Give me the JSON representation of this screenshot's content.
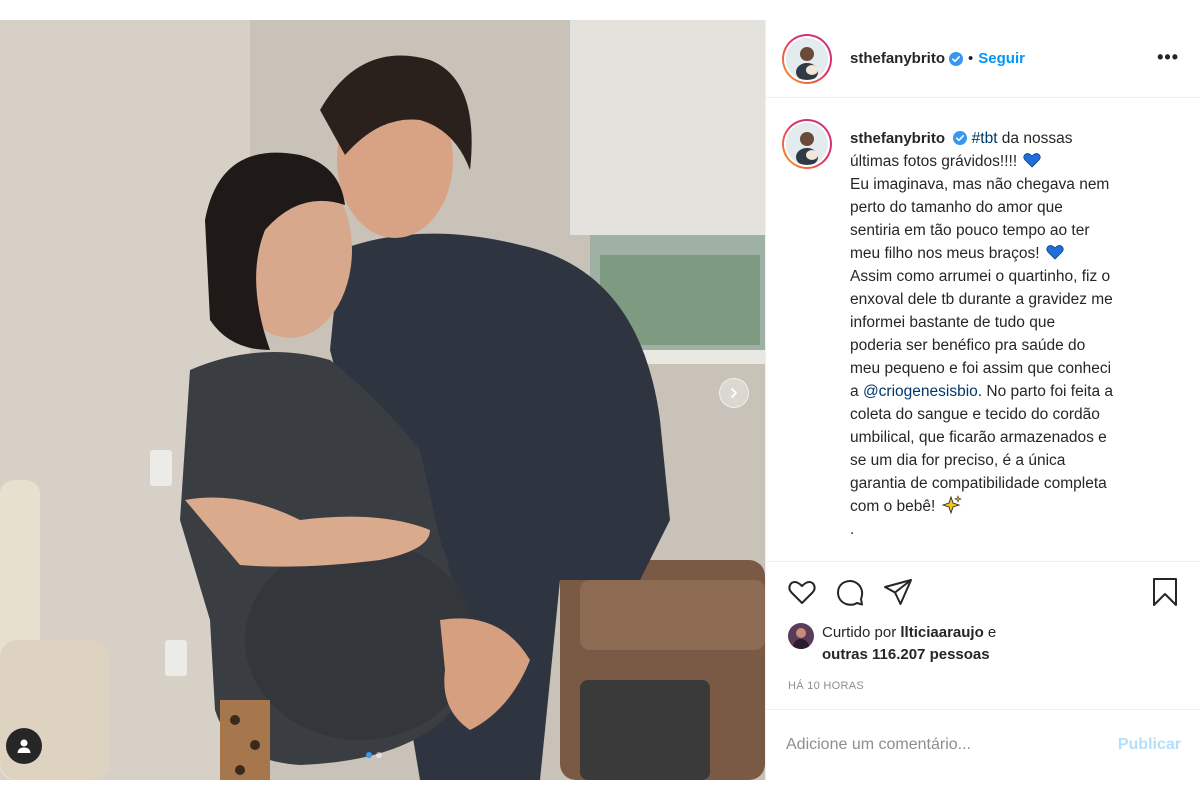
{
  "post": {
    "author": {
      "username": "sthefanybrito",
      "verified": true,
      "avatar_icon": "profile-avatar"
    },
    "header": {
      "separator": "•",
      "follow_label": "Seguir",
      "more_label": "•••"
    },
    "photo": {
      "description_icon": "photo-couple-kissing",
      "carousel_next_icon": "chevron-right-icon",
      "tag_icon": "user-tag-icon",
      "carousel_count": 2,
      "carousel_active": 1
    },
    "caption": {
      "username": "sthefanybrito",
      "hashtag": "#tbt",
      "line1_rest": " da nossas",
      "line2": "últimas fotos grávidos!!!! ",
      "line3": "Eu imaginava, mas não chegava nem",
      "line4": "perto do tamanho do amor que",
      "line5": "sentiria em tão pouco tempo ao ter",
      "line6": "meu filho nos meus braços! ",
      "line7": "Assim como arrumei o quartinho, fiz o",
      "line8": "enxoval dele tb durante a gravidez me",
      "line9": "informei bastante de tudo que",
      "line10": "poderia ser benéfico pra saúde do",
      "line11": "meu pequeno e foi assim que conheci",
      "line12_pre": "a ",
      "mention": "@criogenesisbio",
      "line12_post": ". No parto foi feita a",
      "line13": "coleta do sangue e tecido do cordão",
      "line14": "umbilical, que ficarão armazenados e",
      "line15": "se um dia for preciso, é a única",
      "line16": "garantia de compatibilidade completa",
      "line17": "com o bebê! ",
      "line18": "."
    },
    "likes": {
      "prefix": "Curtido por ",
      "liker": "llticiaaraujo",
      "suffix": " e",
      "others": "outras 116.207 pessoas"
    },
    "timestamp": "HÁ 10 HORAS",
    "comment": {
      "placeholder": "Adicione um comentário...",
      "publish_label": "Publicar"
    }
  },
  "colors": {
    "accent": "#0095f6",
    "verified": "#3897f0",
    "link": "#00376b",
    "heart_blue": "#1e6fd9",
    "muted": "#8e8e8e",
    "publish_disabled": "#b2dffc"
  }
}
